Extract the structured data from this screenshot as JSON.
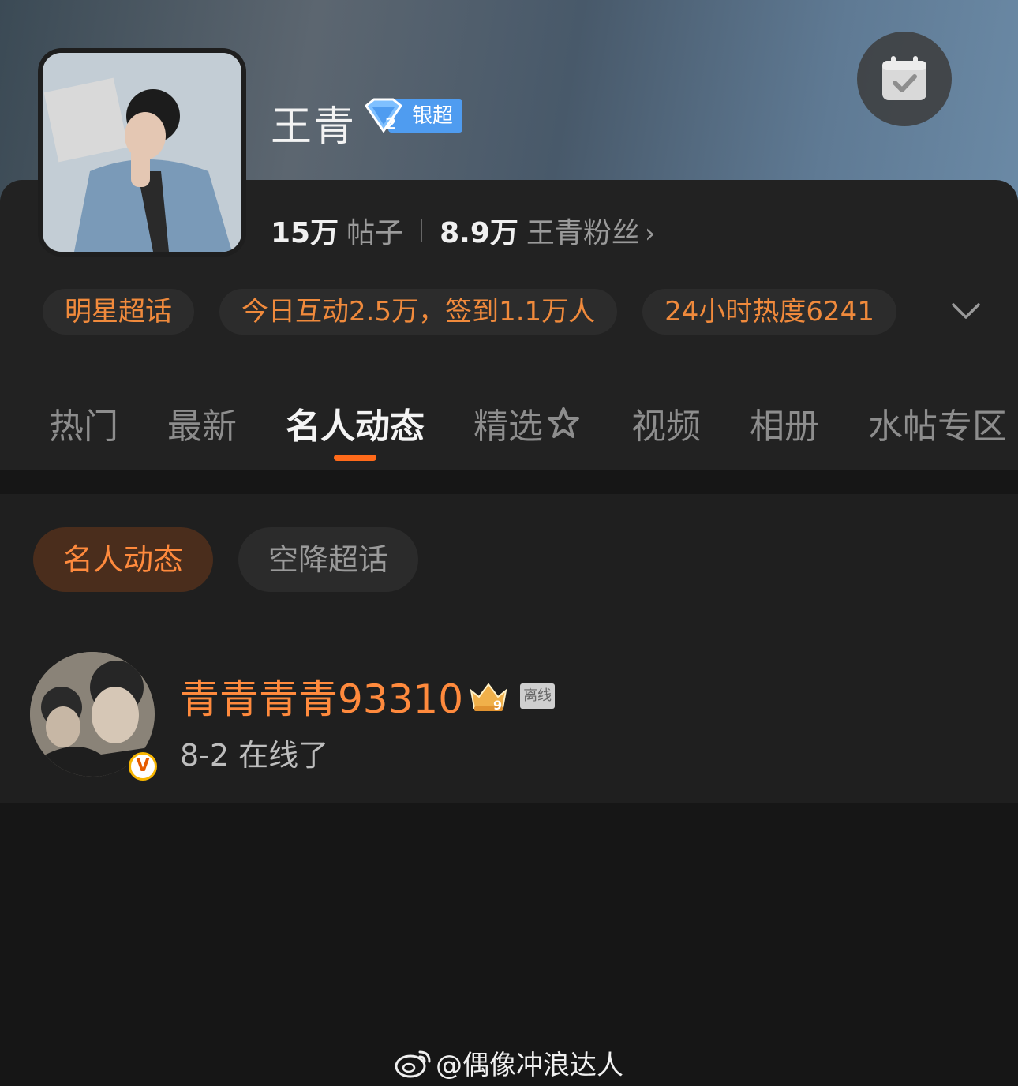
{
  "header": {
    "name": "王青",
    "rank_level": "2",
    "rank_label": "银超",
    "posts_count": "15万",
    "posts_label": "帖子",
    "fans_count": "8.9万",
    "fans_label": "王青粉丝",
    "checkin_icon": "calendar-check-icon"
  },
  "chips": [
    "明星超话",
    "今日互动2.5万，签到1.1万人",
    "24小时热度6241"
  ],
  "tabs": [
    {
      "label": "热门"
    },
    {
      "label": "最新"
    },
    {
      "label": "名人动态",
      "active": true
    },
    {
      "label": "精选"
    },
    {
      "label": "视频"
    },
    {
      "label": "相册"
    },
    {
      "label": "水帖专区"
    }
  ],
  "subtabs": [
    {
      "label": "名人动态",
      "active": true
    },
    {
      "label": "空降超话"
    }
  ],
  "post": {
    "username": "青青青青93310",
    "crown_level": "9",
    "status": "离线",
    "text": "8-2 在线了",
    "badge": "V"
  },
  "watermark": "@偶像冲浪达人",
  "colors": {
    "accent": "#ff6a1a",
    "chip_text": "#f08a3c",
    "rank_blue": "#4f9cf0"
  }
}
